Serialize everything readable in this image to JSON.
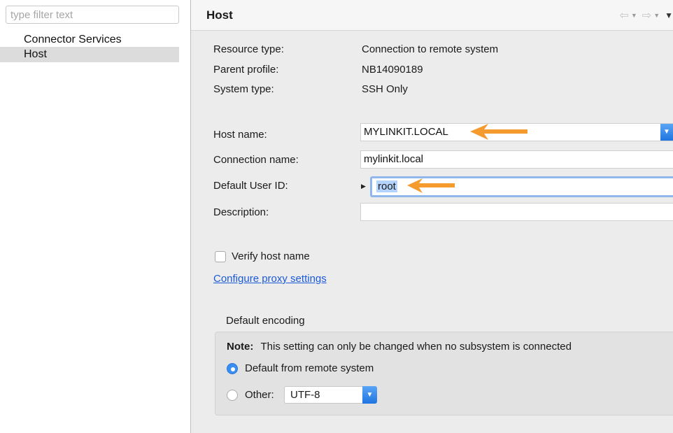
{
  "filter": {
    "placeholder": "type filter text",
    "value": ""
  },
  "tree": {
    "items": [
      {
        "label": "Connector Services",
        "selected": false
      },
      {
        "label": "Host",
        "selected": true
      }
    ]
  },
  "header": {
    "title": "Host",
    "icons": [
      "back-arrow-icon",
      "forward-arrow-icon",
      "view-menu-icon"
    ]
  },
  "info": {
    "resource_type_label": "Resource type:",
    "resource_type_value": "Connection to remote system",
    "parent_profile_label": "Parent profile:",
    "parent_profile_value": "NB14090189",
    "system_type_label": "System type:",
    "system_type_value": "SSH Only"
  },
  "form": {
    "host_name_label": "Host name:",
    "host_name_value": "MYLINKIT.LOCAL",
    "connection_name_label": "Connection name:",
    "connection_name_value": "mylinkit.local",
    "default_user_label": "Default User ID:",
    "default_user_value": "root",
    "description_label": "Description:",
    "description_value": ""
  },
  "verify": {
    "label": "Verify host name",
    "checked": false
  },
  "proxy_link": "Configure proxy settings",
  "encoding": {
    "group_title": "Default encoding",
    "note_bold": "Note:",
    "note_text": "This setting can only be changed when no subsystem is connected",
    "option_default": "Default from remote system",
    "option_other": "Other:",
    "selected_encoding": "UTF-8",
    "selected_option": "default"
  },
  "colors": {
    "accent": "#3a8ef2",
    "annotation_arrow": "#f59a2c",
    "link": "#1a5ad6"
  }
}
